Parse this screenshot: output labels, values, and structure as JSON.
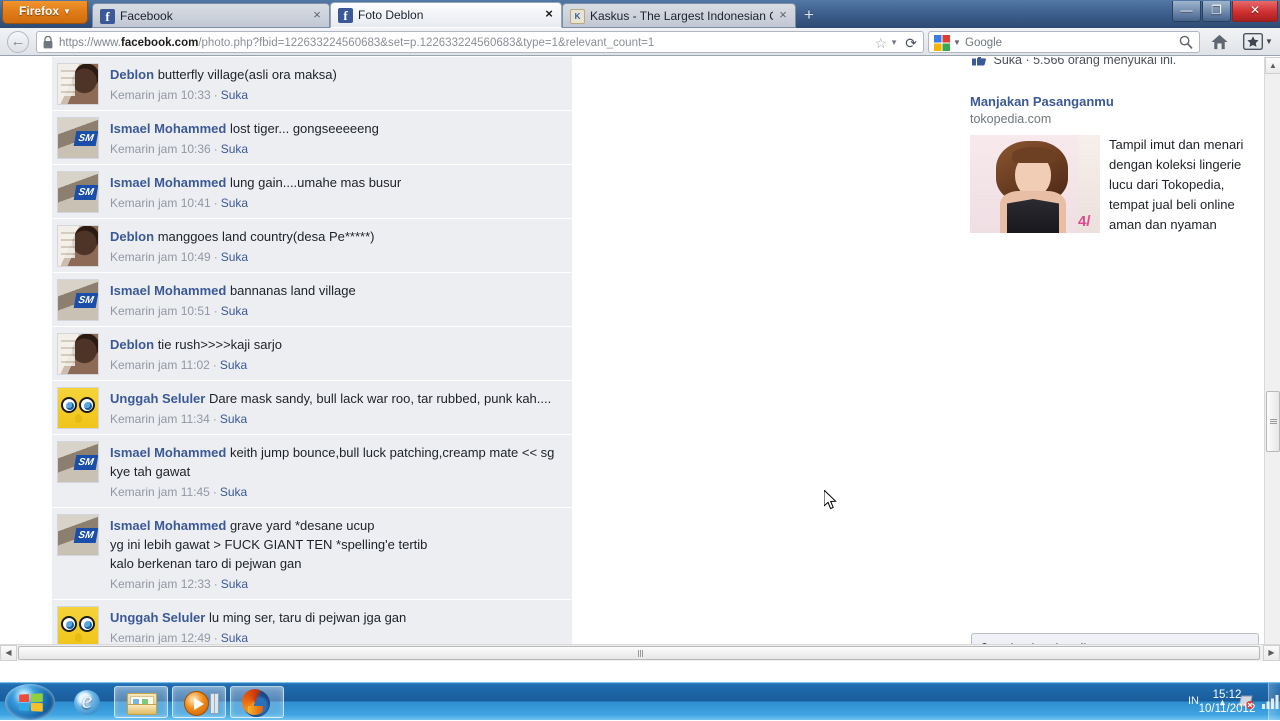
{
  "browser": {
    "app_button": "Firefox",
    "tabs": [
      {
        "label": "Facebook",
        "favicon": "facebook-icon",
        "active": false,
        "close": "×"
      },
      {
        "label": "Foto Deblon",
        "favicon": "facebook-icon",
        "active": true,
        "close": "×"
      },
      {
        "label": "Kaskus - The Largest Indonesian Com...",
        "favicon": "kaskus-icon",
        "active": false,
        "close": "×"
      }
    ],
    "new_tab_label": "+",
    "window_controls": {
      "minimize": "—",
      "maximize": "❐",
      "close": "✕"
    },
    "back_label": "←",
    "url": {
      "protocol": "https://www.",
      "domain": "facebook.com",
      "path": "/photo.php?fbid=122633224560683&set=p.122633224560683&type=1&relevant_count=1",
      "full": "https://www.facebook.com/photo.php?fbid=122633224560683&set=p.122633224560683&type=1&relevant_count=1"
    },
    "star_label": "☆",
    "reload_label": "⟳",
    "search_engine": "Google",
    "search_value": ""
  },
  "page": {
    "like_line": "Suka · 5.566 orang menyukai ini.",
    "comments": [
      {
        "avatar": "deblon",
        "author": "Deblon",
        "text": "butterfly village(asli ora maksa)",
        "time": "Kemarin jam 10:33",
        "like": "Suka"
      },
      {
        "avatar": "sm",
        "author": "Ismael Mohammed",
        "text": "lost tiger... gongseeeeeng",
        "time": "Kemarin jam 10:36",
        "like": "Suka"
      },
      {
        "avatar": "sm",
        "author": "Ismael Mohammed",
        "text": "lung gain....umahe mas busur",
        "time": "Kemarin jam 10:41",
        "like": "Suka"
      },
      {
        "avatar": "deblon",
        "author": "Deblon",
        "text": "manggoes land country(desa Pe*****)",
        "time": "Kemarin jam 10:49",
        "like": "Suka"
      },
      {
        "avatar": "sm",
        "author": "Ismael Mohammed",
        "text": "bannanas land village",
        "time": "Kemarin jam 10:51",
        "like": "Suka"
      },
      {
        "avatar": "deblon",
        "author": "Deblon",
        "text": "tie rush>>>>kaji sarjo",
        "time": "Kemarin jam 11:02",
        "like": "Suka"
      },
      {
        "avatar": "sponge",
        "author": "Unggah Seluler",
        "text": "Dare mask sandy, bull lack war roo, tar rubbed, punk kah....",
        "time": "Kemarin jam 11:34",
        "like": "Suka"
      },
      {
        "avatar": "sm",
        "author": "Ismael Mohammed",
        "text": "keith jump bounce,bull luck patching,creamp mate << sg kye tah gawat",
        "time": "Kemarin jam 11:45",
        "like": "Suka"
      },
      {
        "avatar": "sm",
        "author": "Ismael Mohammed",
        "text": "grave yard *desane ucup\nyg ini lebih gawat > FUCK GIANT TEN *spelling'e tertib\nkalo berkenan taro di pejwan gan",
        "time": "Kemarin jam 12:33",
        "like": "Suka"
      },
      {
        "avatar": "sponge",
        "author": "Unggah Seluler",
        "text": "lu ming ser, taru di pejwan jga gan",
        "time": "Kemarin jam 12:49",
        "like": "Suka"
      }
    ],
    "ad": {
      "title": "Manjakan Pasanganmu",
      "domain": "tokopedia.com",
      "text": "Tampil imut dan menari dengan koleksi lingerie lucu dari Tokopedia, tempat jual beli online aman dan nyaman"
    },
    "chat": {
      "label": "Obrolan (Mati)"
    }
  },
  "taskbar": {
    "start_label": "Start",
    "items": [
      {
        "name": "internet-explorer",
        "open": false
      },
      {
        "name": "windows-explorer",
        "open": true
      },
      {
        "name": "windows-media-player",
        "open": true
      },
      {
        "name": "firefox",
        "open": true
      }
    ],
    "tray": {
      "language": "IN",
      "show_hidden": "▲",
      "icons": [
        "network-icon",
        "signal-icon",
        "battery-icon",
        "volume-icon"
      ]
    },
    "clock": {
      "time": "15:12",
      "date": "10/11/2012"
    }
  },
  "colors": {
    "fb_blue": "#3b5998",
    "comment_bg": "#edeef1",
    "taskbar_blue": "#1f6cb0",
    "firefox_orange": "#e07b18"
  }
}
